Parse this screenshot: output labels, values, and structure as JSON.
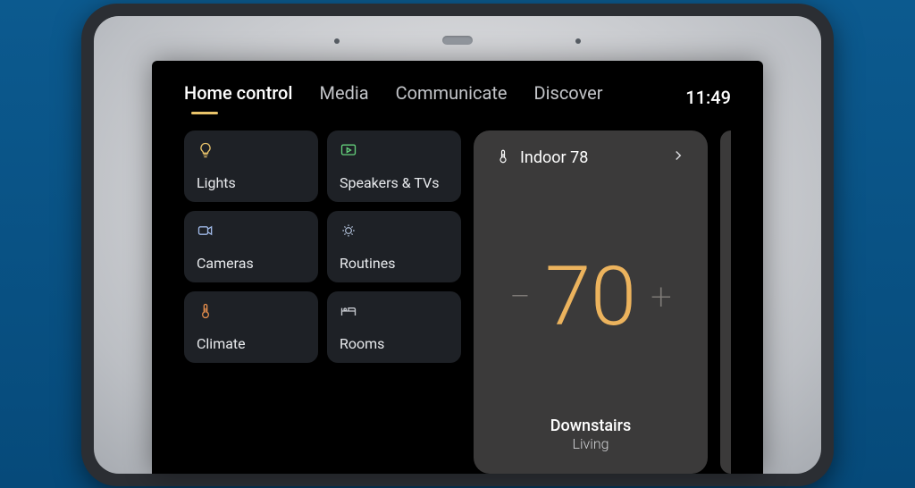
{
  "tabs": {
    "home_control": "Home control",
    "media": "Media",
    "communicate": "Communicate",
    "discover": "Discover",
    "active_index": 0
  },
  "clock": "11:49",
  "tiles": {
    "lights": {
      "label": "Lights"
    },
    "speakers": {
      "label": "Speakers & TVs"
    },
    "cameras": {
      "label": "Cameras"
    },
    "routines": {
      "label": "Routines"
    },
    "climate": {
      "label": "Climate"
    },
    "rooms": {
      "label": "Rooms"
    }
  },
  "thermostat": {
    "indoor_label": "Indoor 78",
    "setpoint": "70",
    "zone": "Downstairs",
    "room": "Living",
    "minus": "−",
    "plus": "+"
  },
  "colors": {
    "accent": "#e9c36a",
    "tile_bg": "#1e2126",
    "card_bg": "#3b3a3a",
    "setpoint": "#ecb35d"
  }
}
